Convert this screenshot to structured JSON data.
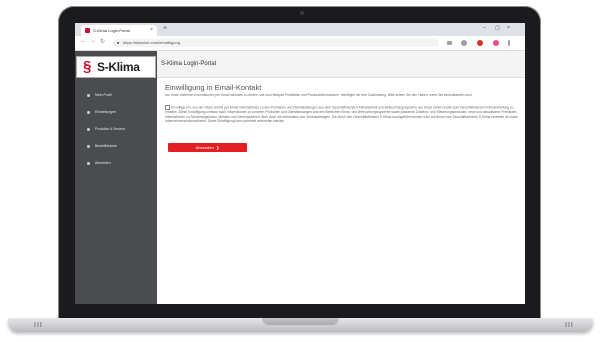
{
  "browser": {
    "tab_title": "S-Klima Login-Portal",
    "tab_close": "×",
    "new_tab": "+",
    "url": "https://skloclub.com/einwilligung",
    "window_controls": [
      "–",
      "▢",
      "×"
    ]
  },
  "sidebar": {
    "logo_text": "S-Klima",
    "items": [
      {
        "label": "Mein Profil",
        "icon": "user-icon"
      },
      {
        "label": "Einstellungen",
        "icon": "gear-icon"
      },
      {
        "label": "Produkte & Service",
        "icon": "box-icon"
      },
      {
        "label": "Bestellhistorie",
        "icon": "clock-icon"
      },
      {
        "label": "Abmelden",
        "icon": "logout-icon"
      }
    ]
  },
  "content": {
    "portal_title": "S-Klima Login-Portal",
    "heading": "Einwilligung in Email-Kontakt",
    "intro": "Um Ihnen weiterhin Informationen per Email schicken zu dürfen, wie zum Beispiel Preislisten und Produktinformationen, benötigen wir Ihre Zustimmung. Bitte setzen Sie den Haken, wenn Sie einverstanden sind.",
    "consent": "Ich willige ein, von der Glück GmbH per Email Informationen zu den Produkten und Dienstleistungen aus dem Geschäftsbereich Klimatechnik und Befeuchtungssysteme der Glück GmbH sowie zum Geschäftsbereich Klimaverteilung zu erhalten. Diese Einwilligung umfasst auch Informationen zu unseren Produkten und Dienstleistungen aus den Bereichen Klima- und Befeuchtungssysteme sowie passende Zubehör- und Steuerungsprodukte, neue und aktualisierte Preislisten, Informationen zu Sonderangeboten, Messen und Seminarplänen. Aber auch die Information von Veranstaltungen. Die durch den Geschäftsbereich S-Klima durchgeführt werden oder auf denen der Geschäftsbereich S-Klima vertreten ist sowie unternehmensinformationen. Diese Einwilligung kann jederzeit widerrufen werden.",
    "submit_label": "Absenden"
  },
  "colors": {
    "accent": "#e31e24",
    "sidebar_bg": "#4a4c4f",
    "logo_red": "#c8102e"
  }
}
